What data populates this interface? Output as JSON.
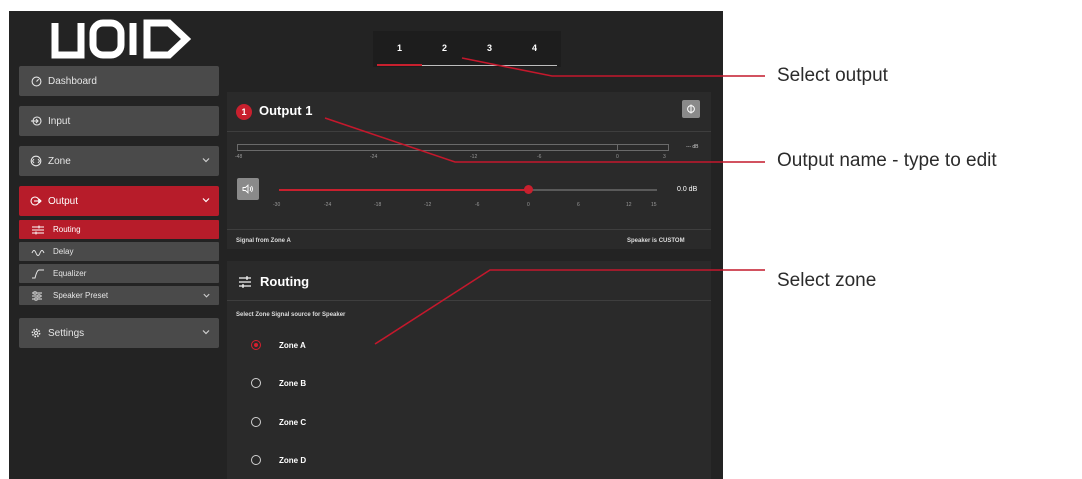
{
  "logo": "VOID",
  "sidebar": {
    "items": [
      {
        "label": "Dashboard",
        "icon": "dashboard-gauge-icon"
      },
      {
        "label": "Input",
        "icon": "input-icon"
      },
      {
        "label": "Zone",
        "icon": "zone-icon"
      },
      {
        "label": "Output",
        "icon": "output-icon"
      },
      {
        "label": "Settings",
        "icon": "gear-icon"
      }
    ],
    "output_sub": [
      {
        "label": "Routing",
        "icon": "routing-icon"
      },
      {
        "label": "Delay",
        "icon": "delay-icon"
      },
      {
        "label": "Equalizer",
        "icon": "equalizer-icon"
      },
      {
        "label": "Speaker Preset",
        "icon": "speaker-preset-icon"
      }
    ]
  },
  "tabs": [
    "1",
    "2",
    "3",
    "4"
  ],
  "output": {
    "badge": "1",
    "title": "Output 1",
    "meter_labels": [
      "-48",
      "-24",
      "-12",
      "-6",
      "0",
      "3"
    ],
    "meter_unit": "--- dB",
    "slider_labels": [
      "-30",
      "-24",
      "-18",
      "-12",
      "-6",
      "0",
      "6",
      "12",
      "15"
    ],
    "gain": "0.0 dB",
    "gain_fraction": 0.66,
    "signal_text": "Signal from Zone A",
    "speaker_text": "Speaker is CUSTOM"
  },
  "routing": {
    "title": "Routing",
    "subtitle": "Select Zone Signal source for Speaker",
    "zones": [
      "Zone A",
      "Zone B",
      "Zone C",
      "Zone D"
    ],
    "selected": "Zone A"
  },
  "annotations": {
    "select_output": "Select output",
    "output_name": "Output name - type to edit",
    "select_zone": "Select zone"
  },
  "colors": {
    "accent": "#b71c2a",
    "background": "#232323",
    "panel": "#2a2a2a",
    "callout_line": "#c4182c"
  }
}
